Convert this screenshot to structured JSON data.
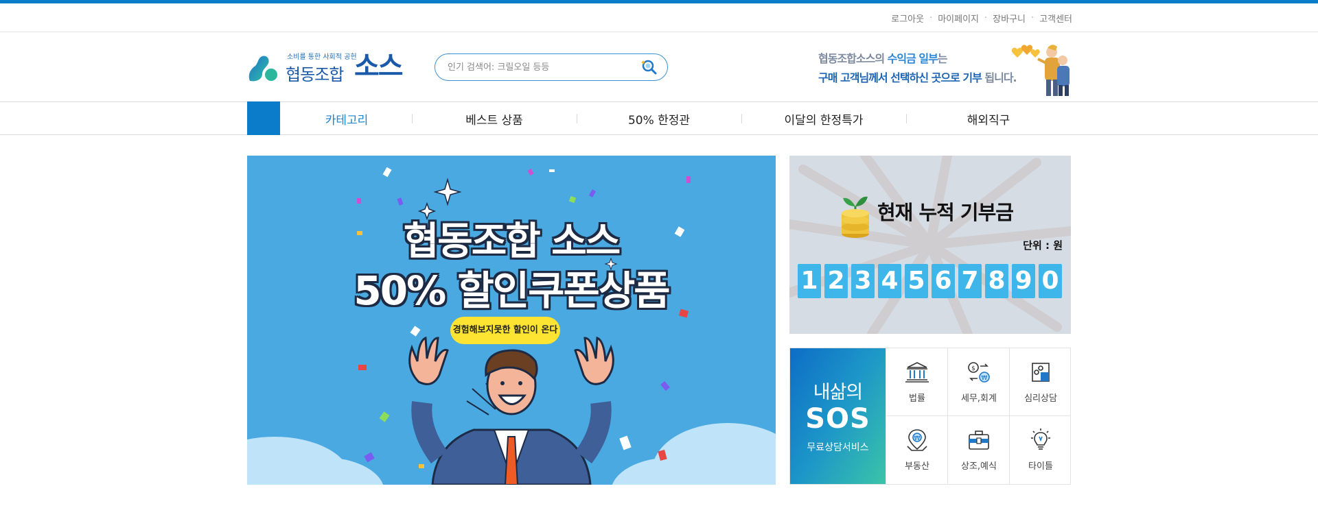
{
  "util_links": [
    "로그아웃",
    "마이페이지",
    "장바구니",
    "고객센터"
  ],
  "logo": {
    "tagline": "소비를 통한 사회적 공헌",
    "name": "협동조합",
    "big": "소스"
  },
  "search": {
    "placeholder": "인기 검색어: 크릴오일 등등",
    "value": ""
  },
  "promo": {
    "line1_a": "협동조합소스의 ",
    "line1_b": "수익금 일부",
    "line1_c": "는",
    "line2_a": "구매 고객님께서 선택하신 곳으로 기부",
    "line2_b": " 됩니다."
  },
  "nav": [
    "카테고리",
    "베스트 상품",
    "50% 한정관",
    "이달의 한정특가",
    "해외직구"
  ],
  "banner": {
    "title1": "협동조합 소스",
    "title2": "50% 할인쿠폰상품",
    "pill": "경험해보지못한 할인이 온다"
  },
  "donation": {
    "title": "현재 누적 기부금",
    "unit": "단위 : 원",
    "digits": [
      "1",
      "2",
      "3",
      "4",
      "5",
      "6",
      "7",
      "8",
      "9",
      "0"
    ]
  },
  "sos": {
    "line1": "내삶의",
    "line2": "SOS",
    "line3": "무료상담서비스",
    "items": [
      {
        "label": "법률",
        "icon": "courthouse-icon"
      },
      {
        "label": "세무,회계",
        "icon": "tax-exchange-icon"
      },
      {
        "label": "심리상담",
        "icon": "puzzle-icon"
      },
      {
        "label": "부동산",
        "icon": "real-estate-pin-icon"
      },
      {
        "label": "상조,예식",
        "icon": "briefcase-icon"
      },
      {
        "label": "타이틀",
        "icon": "lightbulb-icon"
      }
    ]
  },
  "colors": {
    "brand": "#0a7cc9",
    "accent_yellow": "#fde433",
    "digit_bg": "#3fb6ea",
    "banner_bg": "#4aa9e0"
  }
}
